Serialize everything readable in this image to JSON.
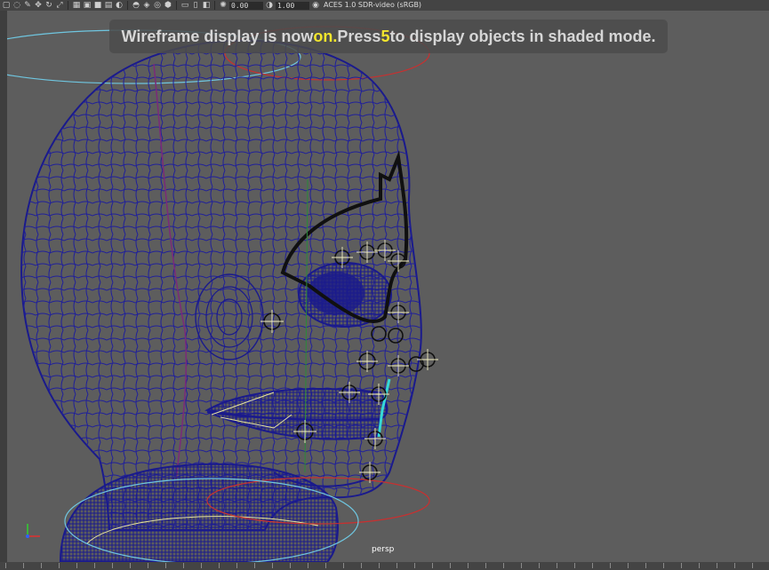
{
  "toolbar": {
    "icons": [
      "select-icon",
      "lasso-icon",
      "paint-icon",
      "move-icon",
      "rotate-icon",
      "scale-icon",
      "grid-icon",
      "wireframe-icon",
      "shaded-icon",
      "textured-icon",
      "lighting-icon",
      "shadows-icon",
      "xray-icon",
      "isolate-icon",
      "camera-icon",
      "film-gate-icon",
      "resolution-gate-icon",
      "gate-mask-icon",
      "exposure-icon",
      "gamma-icon"
    ],
    "exposure_value": "0.00",
    "gamma_value": "1.00",
    "color_management": "ACES 1.0 SDR-video (sRGB)"
  },
  "hud": {
    "prefix": "Wireframe display is now ",
    "state": "on.",
    "middle": "Press ",
    "key": "5",
    "suffix": " to display objects in shaded mode."
  },
  "viewport": {
    "camera": "persp",
    "background_color": "#5d5d5d",
    "wireframe_color": "#1a1a8c",
    "axis_colors": {
      "x": "#e03030",
      "y": "#30d030",
      "z": "#3060ff"
    }
  }
}
